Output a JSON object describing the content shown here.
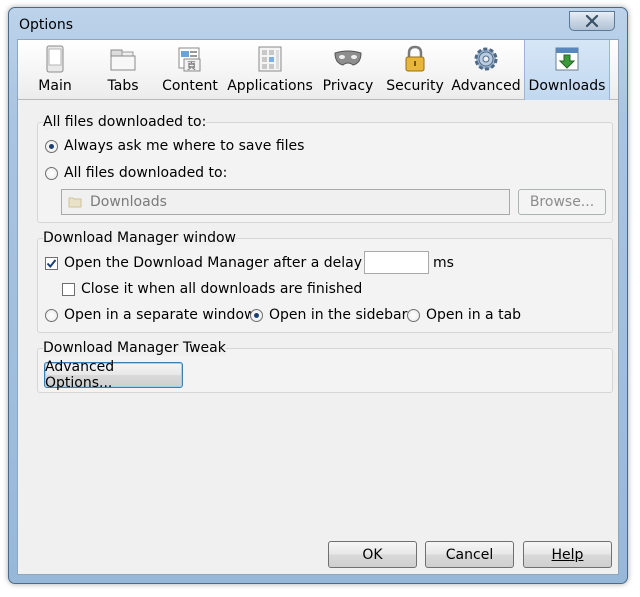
{
  "window": {
    "title": "Options"
  },
  "toolbar": {
    "items": [
      {
        "label": "Main",
        "icon": "device-icon"
      },
      {
        "label": "Tabs",
        "icon": "tabs-icon"
      },
      {
        "label": "Content",
        "icon": "content-icon"
      },
      {
        "label": "Applications",
        "icon": "applications-icon"
      },
      {
        "label": "Privacy",
        "icon": "mask-icon"
      },
      {
        "label": "Security",
        "icon": "lock-icon"
      },
      {
        "label": "Advanced",
        "icon": "gear-icon"
      },
      {
        "label": "Downloads",
        "icon": "download-icon",
        "selected": true
      }
    ]
  },
  "downloads_group": {
    "title": "All files downloaded to:",
    "ask_label": "Always ask me where to save files",
    "ask_selected": true,
    "folder_label": "All files downloaded to:",
    "folder_value": "Downloads",
    "browse_label": "Browse..."
  },
  "manager_group": {
    "title": "Download Manager window",
    "open_delay_label": "Open the Download Manager after a delay of",
    "open_delay_checked": true,
    "delay_value": "",
    "delay_unit": "ms",
    "close_label": "Close it when all downloads are finished",
    "close_checked": false,
    "open_window_label": "Open in a separate window",
    "open_sidebar_label": "Open in the sidebar",
    "open_tab_label": "Open in a tab",
    "open_mode_selected": "sidebar"
  },
  "tweak_group": {
    "title": "Download Manager Tweak",
    "advanced_button": "Advanced Options..."
  },
  "buttons": {
    "ok": "OK",
    "cancel": "Cancel",
    "help": "Help"
  },
  "colors": {
    "accent": "#1b3f73",
    "frame": "#a9c4e0",
    "selected_tab": "#c9dcf0"
  }
}
